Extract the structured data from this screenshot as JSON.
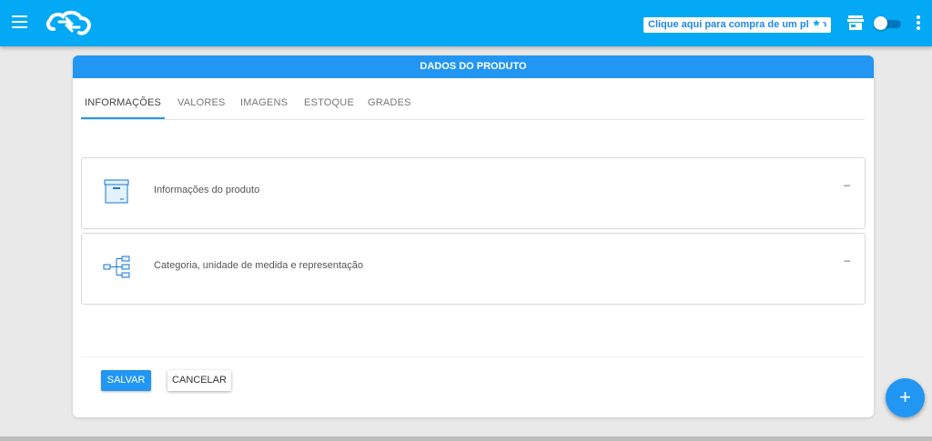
{
  "header": {
    "plan_button_label": "Clique aqui para compra de um plano",
    "icons": [
      "menu-icon",
      "logo",
      "ticket-star-icon",
      "store-icon",
      "theme-toggle",
      "more-vert-icon"
    ],
    "accent_color": "#03a9f4"
  },
  "card": {
    "title": "DADOS DO PRODUTO",
    "tabs": [
      {
        "label": "INFORMAÇÕES",
        "active": true
      },
      {
        "label": "VALORES",
        "active": false
      },
      {
        "label": "IMAGENS",
        "active": false
      },
      {
        "label": "ESTOQUE",
        "active": false
      },
      {
        "label": "GRADES",
        "active": false
      }
    ],
    "panels": [
      {
        "title": "Informações do produto",
        "icon": "box-icon",
        "toggle": "–"
      },
      {
        "title": "Categoria, unidade de medida e representação",
        "icon": "hierarchy-icon",
        "toggle": "–"
      }
    ],
    "actions": {
      "save_label": "SALVAR",
      "cancel_label": "CANCELAR"
    }
  },
  "fab": {
    "label": "+"
  }
}
